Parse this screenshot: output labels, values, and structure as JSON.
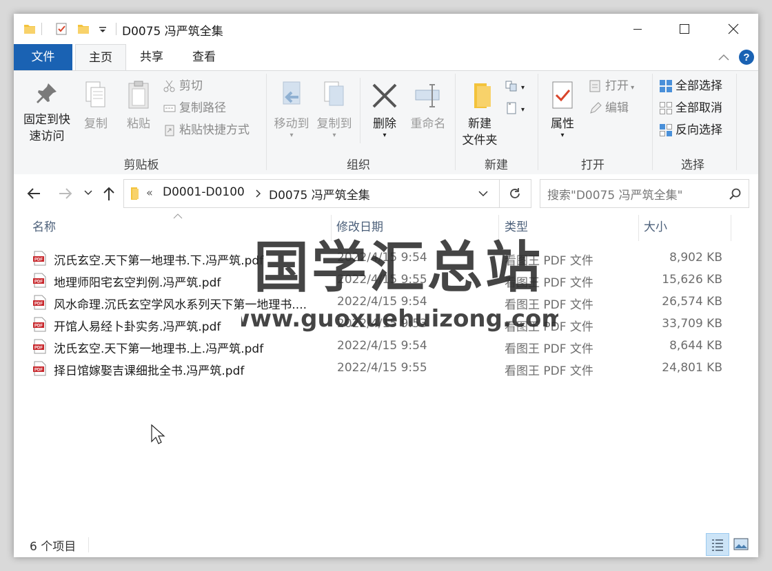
{
  "window": {
    "title": "D0075 冯严筑全集"
  },
  "tabs": {
    "file": "文件",
    "home": "主页",
    "share": "共享",
    "view": "查看"
  },
  "ribbon": {
    "clipboard": {
      "label": "剪贴板",
      "pin": [
        "固定到快",
        "速访问"
      ],
      "copy": "复制",
      "paste": "粘贴",
      "cut": "剪切",
      "copy_path": "复制路径",
      "paste_shortcut": "粘贴快捷方式"
    },
    "organize": {
      "label": "组织",
      "move_to": "移动到",
      "copy_to": "复制到",
      "delete": "删除",
      "rename": "重命名"
    },
    "new": {
      "label": "新建",
      "new_folder": [
        "新建",
        "文件夹"
      ]
    },
    "open": {
      "label": "打开",
      "properties": "属性",
      "open": "打开",
      "edit": "编辑"
    },
    "select": {
      "label": "选择",
      "select_all": "全部选择",
      "select_none": "全部取消",
      "invert": "反向选择"
    }
  },
  "address": {
    "overflow": "«",
    "crumbs": [
      "D0001-D0100",
      "D0075 冯严筑全集"
    ],
    "search_placeholder": "搜索\"D0075 冯严筑全集\""
  },
  "columns": {
    "name": "名称",
    "date": "修改日期",
    "type": "类型",
    "size": "大小"
  },
  "files": [
    {
      "name": "沉氏玄空.天下第一地理书.下.冯严筑.pdf",
      "date": "2022/4/15 9:54",
      "type": "看图王 PDF 文件",
      "size": "8,902 KB"
    },
    {
      "name": "地理师阳宅玄空判例.冯严筑.pdf",
      "date": "2022/4/15 9:55",
      "type": "看图王 PDF 文件",
      "size": "15,626 KB"
    },
    {
      "name": "风水命理.沉氏玄空学风水系列天下第一地理书....",
      "date": "2022/4/15 9:54",
      "type": "看图王 PDF 文件",
      "size": "26,574 KB"
    },
    {
      "name": "开馆人易经卜卦实务.冯严筑.pdf",
      "date": "2022/4/15 9:53",
      "type": "看图王 PDF 文件",
      "size": "33,709 KB"
    },
    {
      "name": "沈氏玄空.天下第一地理书.上.冯严筑.pdf",
      "date": "2022/4/15 9:54",
      "type": "看图王 PDF 文件",
      "size": "8,644 KB"
    },
    {
      "name": "择日馆嫁娶吉课细批全书.冯严筑.pdf",
      "date": "2022/4/15 9:55",
      "type": "看图王 PDF 文件",
      "size": "24,801 KB"
    }
  ],
  "status": {
    "count": "6 个项目"
  },
  "watermark": {
    "title": "国学汇总站",
    "url": "www.guoxuehuizong.com"
  },
  "colors": {
    "accent": "#1a62b3",
    "folder": "#f3c33b",
    "pdf_red": "#c8282d"
  }
}
